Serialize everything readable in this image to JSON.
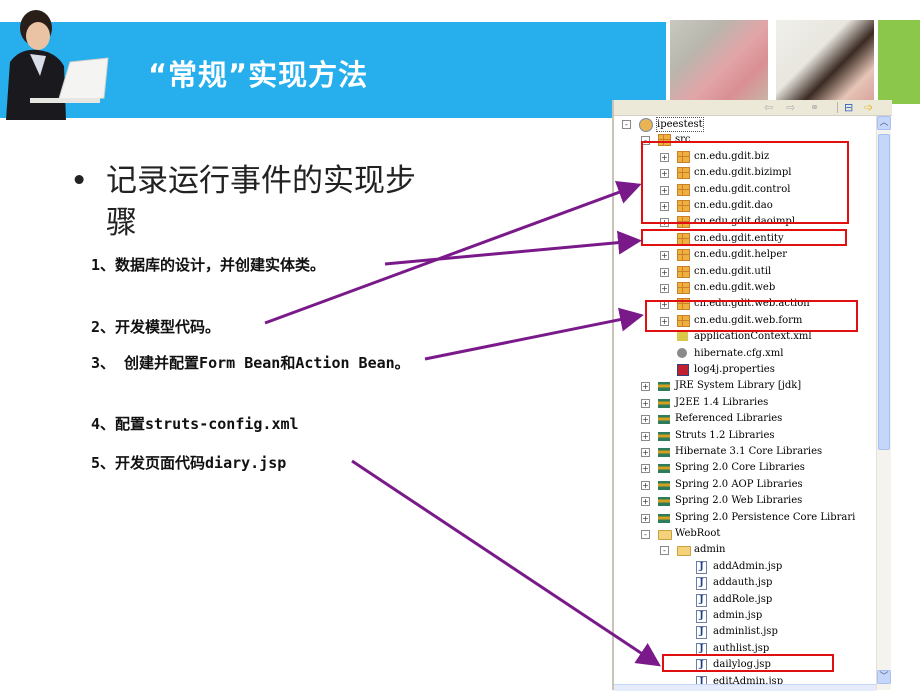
{
  "header": {
    "title": "“常规”实现方法",
    "banner_color": "#27aeed",
    "accent_green": "#8ac74a"
  },
  "bullet": {
    "dot": "•",
    "text": "记录运行事件的实现步骤"
  },
  "steps": [
    "1、数据库的设计，并创建实体类。",
    "2、开发模型代码。",
    "3、 创建并配置Form Bean和Action Bean。",
    "4、配置struts-config.xml",
    "5、开发页面代码diary.jsp"
  ],
  "explorer": {
    "toolbar_icons": [
      "back-icon",
      "forward-icon",
      "link-icon",
      "collapse-all-icon",
      "sync-arrow-icon"
    ],
    "tree": [
      {
        "label": "ipeestest",
        "type": "project",
        "level": 0,
        "expander": "-"
      },
      {
        "label": "src",
        "type": "source-folder",
        "level": 1,
        "expander": "-"
      },
      {
        "label": "cn.edu.gdit.biz",
        "type": "package",
        "level": 2,
        "expander": "+"
      },
      {
        "label": "cn.edu.gdit.bizimpl",
        "type": "package",
        "level": 2,
        "expander": "+"
      },
      {
        "label": "cn.edu.gdit.control",
        "type": "package",
        "level": 2,
        "expander": "+"
      },
      {
        "label": "cn.edu.gdit.dao",
        "type": "package",
        "level": 2,
        "expander": "+"
      },
      {
        "label": "cn.edu.gdit.daoimpl",
        "type": "package",
        "level": 2,
        "expander": "+"
      },
      {
        "label": "cn.edu.gdit.entity",
        "type": "package",
        "level": 2,
        "expander": ""
      },
      {
        "label": "cn.edu.gdit.helper",
        "type": "package",
        "level": 2,
        "expander": "+"
      },
      {
        "label": "cn.edu.gdit.util",
        "type": "package",
        "level": 2,
        "expander": "+"
      },
      {
        "label": "cn.edu.gdit.web",
        "type": "package",
        "level": 2,
        "expander": "+"
      },
      {
        "label": "cn.edu.gdit.web.action",
        "type": "package",
        "level": 2,
        "expander": "+"
      },
      {
        "label": "cn.edu.gdit.web.form",
        "type": "package",
        "level": 2,
        "expander": "+"
      },
      {
        "label": "applicationContext.xml",
        "type": "xml",
        "level": 2,
        "expander": ""
      },
      {
        "label": "hibernate.cfg.xml",
        "type": "cfg",
        "level": 2,
        "expander": ""
      },
      {
        "label": "log4j.properties",
        "type": "props",
        "level": 2,
        "expander": ""
      },
      {
        "label": "JRE System Library [jdk]",
        "type": "library",
        "level": 1,
        "expander": "+"
      },
      {
        "label": "J2EE 1.4 Libraries",
        "type": "library",
        "level": 1,
        "expander": "+"
      },
      {
        "label": "Referenced Libraries",
        "type": "library",
        "level": 1,
        "expander": "+"
      },
      {
        "label": "Struts 1.2 Libraries",
        "type": "library",
        "level": 1,
        "expander": "+"
      },
      {
        "label": "Hibernate 3.1 Core Libraries",
        "type": "library",
        "level": 1,
        "expander": "+"
      },
      {
        "label": "Spring 2.0 Core Libraries",
        "type": "library",
        "level": 1,
        "expander": "+"
      },
      {
        "label": "Spring 2.0 AOP Libraries",
        "type": "library",
        "level": 1,
        "expander": "+"
      },
      {
        "label": "Spring 2.0 Web Libraries",
        "type": "library",
        "level": 1,
        "expander": "+"
      },
      {
        "label": "Spring 2.0 Persistence Core Librari",
        "type": "library",
        "level": 1,
        "expander": "+"
      },
      {
        "label": "WebRoot",
        "type": "folder",
        "level": 1,
        "expander": "-"
      },
      {
        "label": "admin",
        "type": "folder",
        "level": 2,
        "expander": "-"
      },
      {
        "label": "addAdmin.jsp",
        "type": "jsp",
        "level": 3,
        "expander": ""
      },
      {
        "label": "addauth.jsp",
        "type": "jsp",
        "level": 3,
        "expander": ""
      },
      {
        "label": "addRole.jsp",
        "type": "jsp",
        "level": 3,
        "expander": ""
      },
      {
        "label": "admin.jsp",
        "type": "jsp",
        "level": 3,
        "expander": ""
      },
      {
        "label": "adminlist.jsp",
        "type": "jsp",
        "level": 3,
        "expander": ""
      },
      {
        "label": "authlist.jsp",
        "type": "jsp",
        "level": 3,
        "expander": ""
      },
      {
        "label": "dailylog.jsp",
        "type": "jsp",
        "level": 3,
        "expander": ""
      },
      {
        "label": "editAdmin.jsp",
        "type": "jsp",
        "level": 3,
        "expander": ""
      }
    ],
    "scroll_up": "︿",
    "scroll_down": "﹀"
  },
  "annotations": {
    "highlight_color": "#e01010",
    "arrow_color": "#7a1a8a"
  }
}
